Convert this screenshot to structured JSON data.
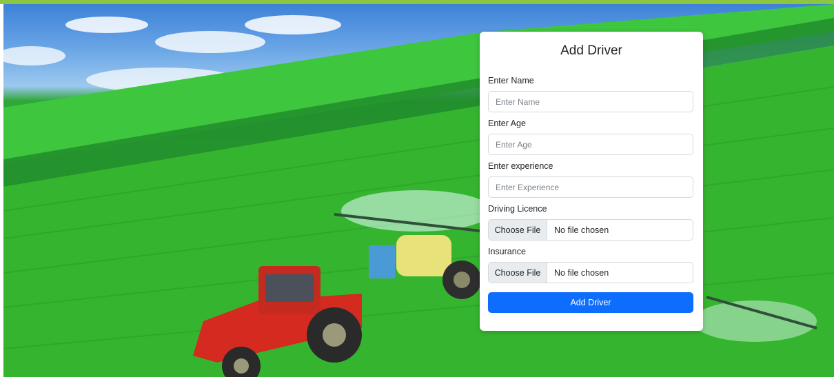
{
  "form": {
    "title": "Add Driver",
    "name_label": "Enter Name",
    "name_placeholder": "Enter Name",
    "age_label": "Enter Age",
    "age_placeholder": "Enter Age",
    "experience_label": "Enter experience",
    "experience_placeholder": "Enter Experience",
    "licence_label": "Driving Licence",
    "licence_button": "Choose File",
    "licence_status": "No file chosen",
    "insurance_label": "Insurance",
    "insurance_button": "Choose File",
    "insurance_status": "No file chosen",
    "submit_label": "Add Driver"
  },
  "colors": {
    "top_bar": "#8cc63f",
    "primary_button": "#0d6efd"
  }
}
